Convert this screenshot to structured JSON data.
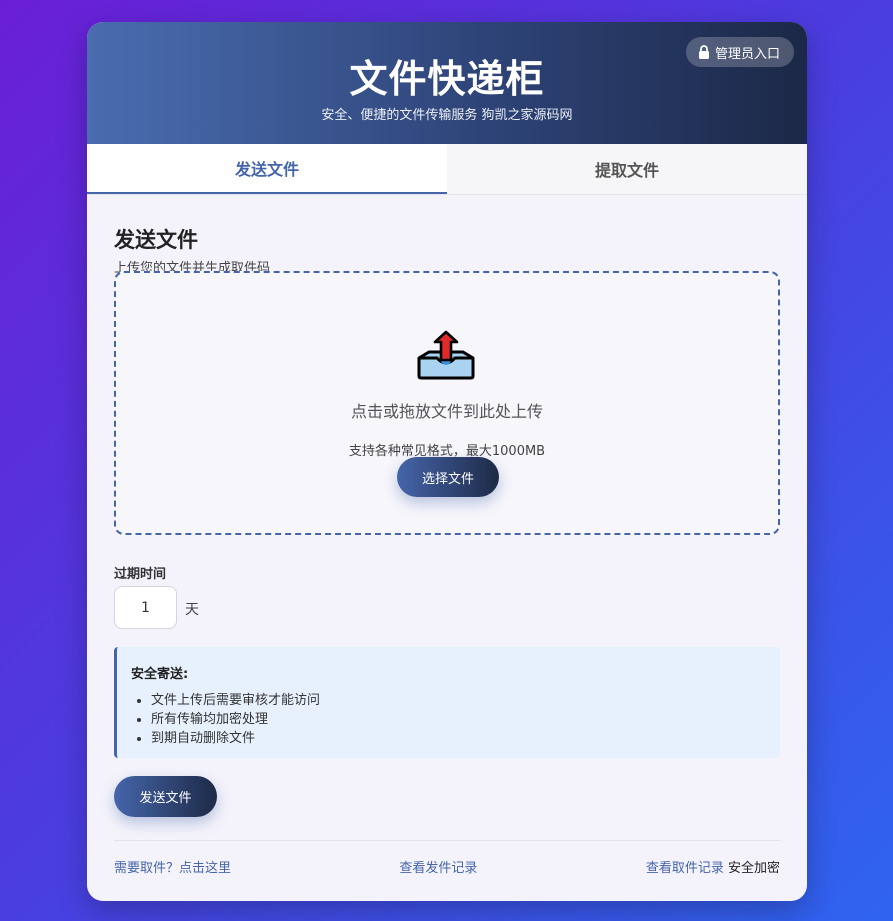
{
  "header": {
    "title": "文件快递柜",
    "subtitle": "安全、便捷的文件传输服务 狗凯之家源码网",
    "admin_label": "管理员入口"
  },
  "tabs": [
    {
      "label": "发送文件",
      "active": true
    },
    {
      "label": "提取文件",
      "active": false
    }
  ],
  "send": {
    "title": "发送文件",
    "description": "上传您的文件并生成取件码",
    "dropzone": {
      "main_text": "点击或拖放文件到此处上传",
      "sub_text": "支持各种常见格式，最大1000MB",
      "choose_label": "选择文件"
    },
    "expire": {
      "label": "过期时间",
      "value": "1",
      "unit": "天"
    },
    "notice": {
      "title": "安全寄送:",
      "items": [
        "文件上传后需要审核才能访问",
        "所有传输均加密处理",
        "到期自动删除文件"
      ]
    },
    "send_label": "发送文件"
  },
  "footer": {
    "pickup_link": "需要取件？点击这里",
    "send_records": "查看发件记录",
    "pickup_records": "查看取件记录",
    "secure_text": "安全加密"
  },
  "colors": {
    "accent": "#4565aa",
    "header_dark": "#1c2847",
    "bg_start": "#6a1fd6",
    "bg_end": "#2f64f0"
  }
}
